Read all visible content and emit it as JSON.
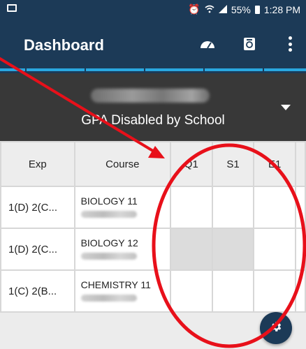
{
  "status_bar": {
    "battery": "55%",
    "time": "1:28 PM",
    "icons": [
      "mail-icon",
      "alarm-icon",
      "wifi-icon",
      "signal-icon",
      "battery-icon"
    ]
  },
  "app_bar": {
    "title": "Dashboard",
    "icons": [
      "gauge-icon",
      "report-card-icon",
      "overflow-menu-icon"
    ]
  },
  "header": {
    "school_status": "GPA Disabled by School"
  },
  "table": {
    "headers": {
      "exp": "Exp",
      "course": "Course",
      "q1": "Q1",
      "s1": "S1",
      "e1": "E1"
    },
    "rows": [
      {
        "exp": "1(D) 2(C...",
        "course": "BIOLOGY 11"
      },
      {
        "exp": "1(D) 2(C...",
        "course": "BIOLOGY 12"
      },
      {
        "exp": "1(C) 2(B...",
        "course": "CHEMISTRY 11"
      }
    ]
  },
  "colors": {
    "app_bar": "#1c3a57",
    "accent": "#29a8e0",
    "header_panel": "#383838",
    "annotation": "#e8101a"
  },
  "fab": {
    "icon": "gear-icon"
  }
}
